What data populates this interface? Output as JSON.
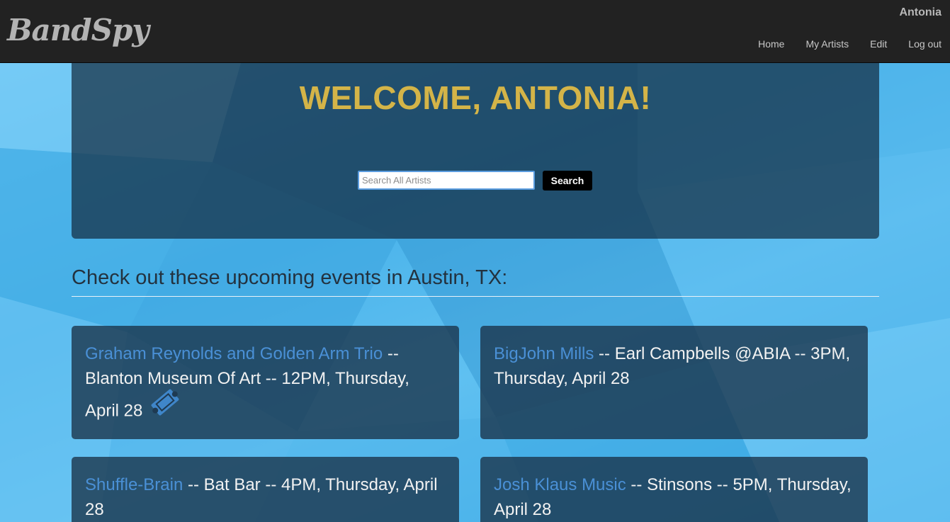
{
  "header": {
    "logo": "BandSpy",
    "username": "Antonia",
    "nav": [
      "Home",
      "My Artists",
      "Edit",
      "Log out"
    ]
  },
  "hero": {
    "title": "WELCOME, ANTONIA!",
    "search_placeholder": "Search All Artists",
    "search_value": "",
    "search_button": "Search"
  },
  "events": {
    "heading": "Check out these upcoming events in Austin, TX:",
    "items": [
      {
        "artist": "Graham Reynolds and Golden Arm Trio",
        "details": " -- Blanton Museum Of Art -- 12PM, Thursday, April 28",
        "ticket_icon": "ticket-icon"
      },
      {
        "artist": "BigJohn Mills",
        "details": " -- Earl Campbells @ABIA -- 3PM, Thursday, April 28"
      },
      {
        "artist": "Shuffle-Brain",
        "details": " -- Bat Bar -- 4PM, Thursday, April 28"
      },
      {
        "artist": "Josh Klaus Music",
        "details": " -- Stinsons -- 5PM, Thursday, April 28"
      }
    ]
  },
  "colors": {
    "navbar": "#222222",
    "title_gold": "#d4b448",
    "artist_link": "#4a90d6",
    "panel": "#142d41"
  }
}
